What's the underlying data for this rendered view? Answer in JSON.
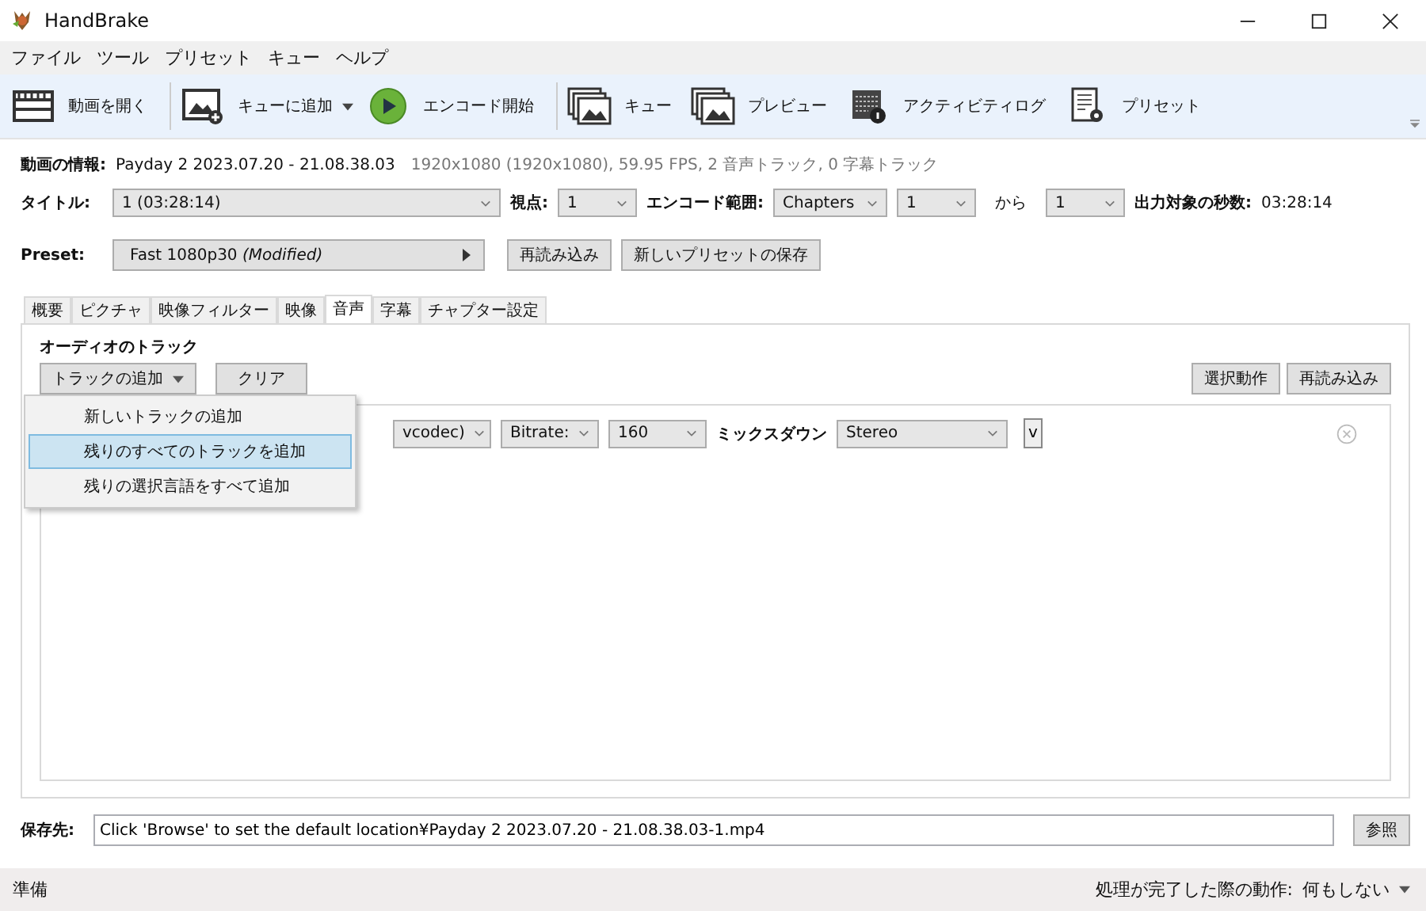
{
  "window": {
    "title": "HandBrake"
  },
  "menu": [
    "ファイル",
    "ツール",
    "プリセット",
    "キュー",
    "ヘルプ"
  ],
  "toolbar": [
    {
      "kind": "clapper",
      "label": "動画を開く",
      "dropdown": false
    },
    {
      "kind": "add",
      "label": "キューに追加",
      "dropdown": true
    },
    {
      "kind": "play",
      "label": "エンコード開始",
      "dropdown": false
    },
    {
      "kind": "stack",
      "label": "キュー",
      "dropdown": false
    },
    {
      "kind": "stack",
      "label": "プレビュー",
      "dropdown": false
    },
    {
      "kind": "log",
      "label": "アクティビティログ",
      "dropdown": false
    },
    {
      "kind": "preset",
      "label": "プリセット",
      "dropdown": false
    }
  ],
  "source": {
    "label": "動画の情報:",
    "name": "Payday 2 2023.07.20 - 21.08.38.03",
    "details": "1920x1080 (1920x1080), 59.95 FPS, 2 音声トラック, 0 字幕トラック"
  },
  "title_row": {
    "title_label": "タイトル:",
    "title_value": "1  (03:28:14)",
    "angle_label": "視点:",
    "angle_value": "1",
    "range_label": "エンコード範囲:",
    "range_mode": "Chapters",
    "range_start": "1",
    "range_to": "から",
    "range_end": "1",
    "duration_label": "出力対象の秒数:",
    "duration": "03:28:14"
  },
  "preset": {
    "label": "Preset:",
    "name": "Fast 1080p30",
    "modified": "(Modified)",
    "buttons": [
      "再読み込み",
      "新しいプリセットの保存"
    ]
  },
  "tabs": [
    {
      "label": "概要",
      "selected": false
    },
    {
      "label": "ピクチャ",
      "selected": false
    },
    {
      "label": "映像フィルター",
      "selected": false
    },
    {
      "label": "映像",
      "selected": false
    },
    {
      "label": "音声",
      "selected": true
    },
    {
      "label": "字幕",
      "selected": false
    },
    {
      "label": "チャプター設定",
      "selected": false
    }
  ],
  "audio": {
    "heading": "オーディオのトラック",
    "add_button": "トラックの追加",
    "clear_button": "クリア",
    "right_buttons": [
      "選択動作",
      "再読み込み"
    ],
    "menu_items": [
      {
        "label": "新しいトラックの追加",
        "selected": false
      },
      {
        "label": "残りのすべてのトラックを追加",
        "selected": true
      },
      {
        "label": "残りの選択言語をすべて追加",
        "selected": false
      }
    ],
    "track": {
      "codec": "vcodec)",
      "mode": "Bitrate:",
      "bitrate": "160",
      "mixdown_label": "ミックスダウン",
      "mixdown": "Stereo",
      "extra": "v"
    }
  },
  "destination": {
    "label": "保存先:",
    "value": "Click 'Browse' to set the default location¥Payday 2 2023.07.20 - 21.08.38.03-1.mp4",
    "button": "参照"
  },
  "status_bar": {
    "status": "準備",
    "when_done_label": "処理が完了した際の動作:",
    "when_done": "何もしない"
  }
}
